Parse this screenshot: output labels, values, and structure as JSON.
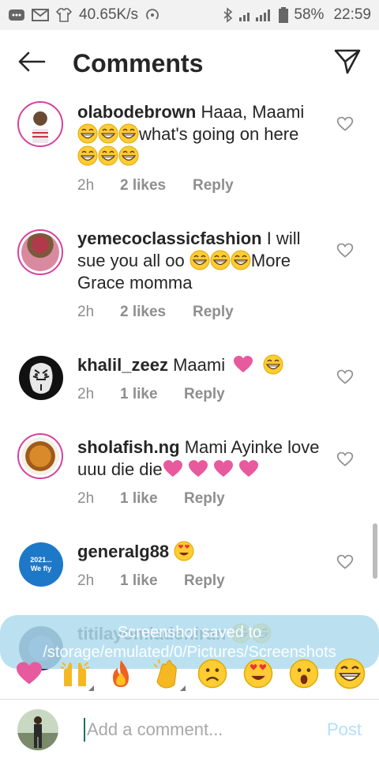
{
  "status": {
    "speed": "40.65K/s",
    "battery": "58%",
    "time": "22:59"
  },
  "header": {
    "title": "Comments"
  },
  "comments": [
    {
      "username": "olabodebrown",
      "text_a": "Haaa, Maami",
      "text_b": "what's going on here",
      "time": "2h",
      "likes": "2 likes",
      "reply": "Reply"
    },
    {
      "username": "yemecoclassicfashion",
      "text_a": "I will sue you all oo",
      "text_b": "More Grace momma",
      "time": "2h",
      "likes": "2 likes",
      "reply": "Reply"
    },
    {
      "username": "khalil_zeez",
      "text_a": "Maami",
      "time": "2h",
      "likes": "1 like",
      "reply": "Reply"
    },
    {
      "username": "sholafish.ng",
      "text_a": "Mami Ayinke love uuu die die",
      "time": "2h",
      "likes": "1 like",
      "reply": "Reply"
    },
    {
      "username": "generalg88",
      "time": "2h",
      "likes": "1 like",
      "reply": "Reply",
      "avatar_text": "2021... We fly"
    },
    {
      "username": "titilayomiadeniran"
    }
  ],
  "toast": {
    "text": "Screenshot saved to /storage/emulated/0/Pictures/Screenshots"
  },
  "emoji_bar": [
    "heart",
    "raised-hands",
    "fire",
    "clap",
    "sad",
    "heart-eyes",
    "surprised",
    "grin"
  ],
  "composer": {
    "placeholder": "Add a comment...",
    "post_label": "Post"
  },
  "colors": {
    "accent": "#0095f6",
    "post_disabled": "#b2dffc",
    "heart": "#e75a9d",
    "ring": "#d6429c"
  }
}
